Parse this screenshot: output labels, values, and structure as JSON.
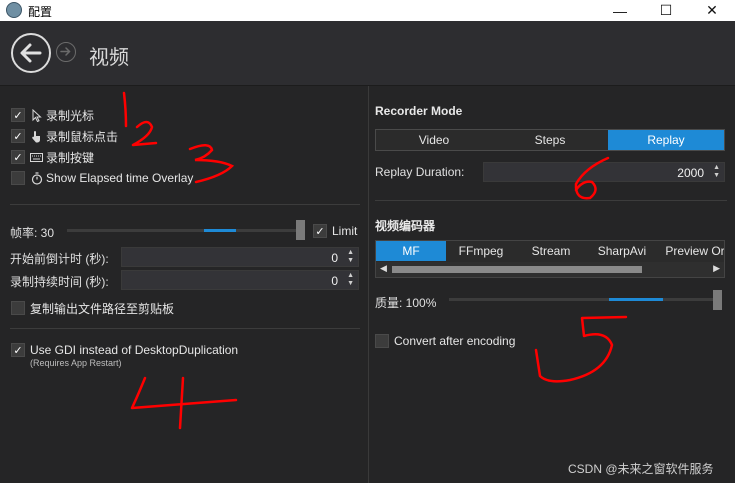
{
  "window": {
    "title": "配置",
    "minimize_label": "—",
    "maximize_label": "☐",
    "close_label": "✕"
  },
  "header": {
    "title": "视频",
    "back_icon": "arrow-left-icon",
    "forward_icon": "arrow-right-icon"
  },
  "left": {
    "record_cursor": {
      "label": "录制光标",
      "checked": true,
      "icon": "cursor-icon"
    },
    "record_clicks": {
      "label": "录制鼠标点击",
      "checked": true,
      "icon": "hand-pointer-icon"
    },
    "record_keys": {
      "label": "录制按键",
      "checked": true,
      "icon": "keyboard-icon"
    },
    "elapsed_overlay": {
      "label": "Show Elapsed time Overlay",
      "checked": false,
      "icon": "stopwatch-icon"
    },
    "fps": {
      "label": "帧率: 30",
      "value": 30,
      "limit_label": "Limit",
      "limit_checked": true
    },
    "start_delay": {
      "label": "开始前倒计时 (秒):",
      "value": "0"
    },
    "duration": {
      "label": "录制持续时间 (秒):",
      "value": "0"
    },
    "copy_path": {
      "label": "复制输出文件路径至剪贴板",
      "checked": false
    },
    "use_gdi": {
      "label": "Use GDI instead of DesktopDuplication",
      "note": "(Requires App Restart)",
      "checked": true
    }
  },
  "right": {
    "recorder_mode": {
      "title": "Recorder Mode",
      "options": [
        "Video",
        "Steps",
        "Replay"
      ],
      "selected": "Replay"
    },
    "replay_duration": {
      "label": "Replay Duration:",
      "value": "2000"
    },
    "encoder": {
      "title": "视频编码器",
      "tabs": [
        "MF",
        "FFmpeg",
        "Stream",
        "SharpAvi",
        "Preview Or"
      ],
      "selected": "MF",
      "scroll_left": "◀",
      "scroll_right": "▶"
    },
    "quality": {
      "label": "质量: 100%",
      "percent": 100
    },
    "convert_after": {
      "label": "Convert after encoding",
      "checked": false
    }
  },
  "annotations": [
    "1",
    "2",
    "3",
    "4",
    "5",
    "6"
  ],
  "watermark": "CSDN @未来之窗软件服务",
  "colors": {
    "accent": "#1e8ad6",
    "background": "#252526",
    "annotation": "#ff0000"
  }
}
